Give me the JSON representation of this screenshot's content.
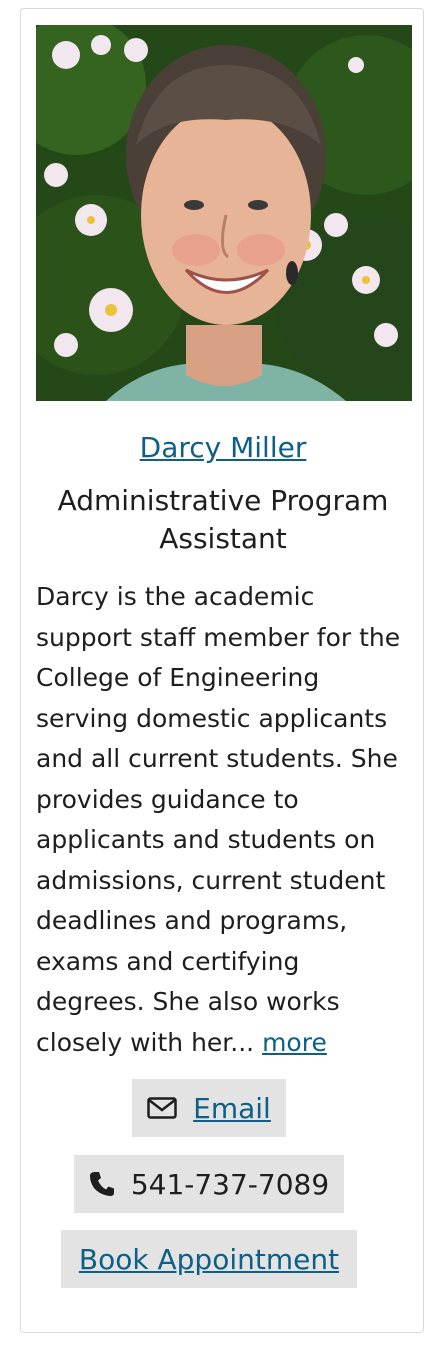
{
  "profile": {
    "name": "Darcy Miller",
    "title": "Administrative Program Assistant",
    "bio_lines": [
      "Darcy is the academic",
      "support staff member for the",
      "College of Engineering",
      "serving domestic applicants",
      "and all current students. She",
      "provides guidance to",
      "applicants and students on",
      "admissions, current student",
      "deadlines and programs,",
      "exams and certifying",
      "degrees. She also works",
      "closely with her..."
    ],
    "more_label": "more"
  },
  "actions": {
    "email_label": "Email",
    "email_icon": "envelope-icon",
    "phone_number": "541-737-7089",
    "phone_icon": "phone-icon",
    "book_label": "Book Appointment"
  },
  "colors": {
    "link": "#0d5f87",
    "button_bg": "#e3e3e3",
    "text": "#1e1e1e"
  }
}
